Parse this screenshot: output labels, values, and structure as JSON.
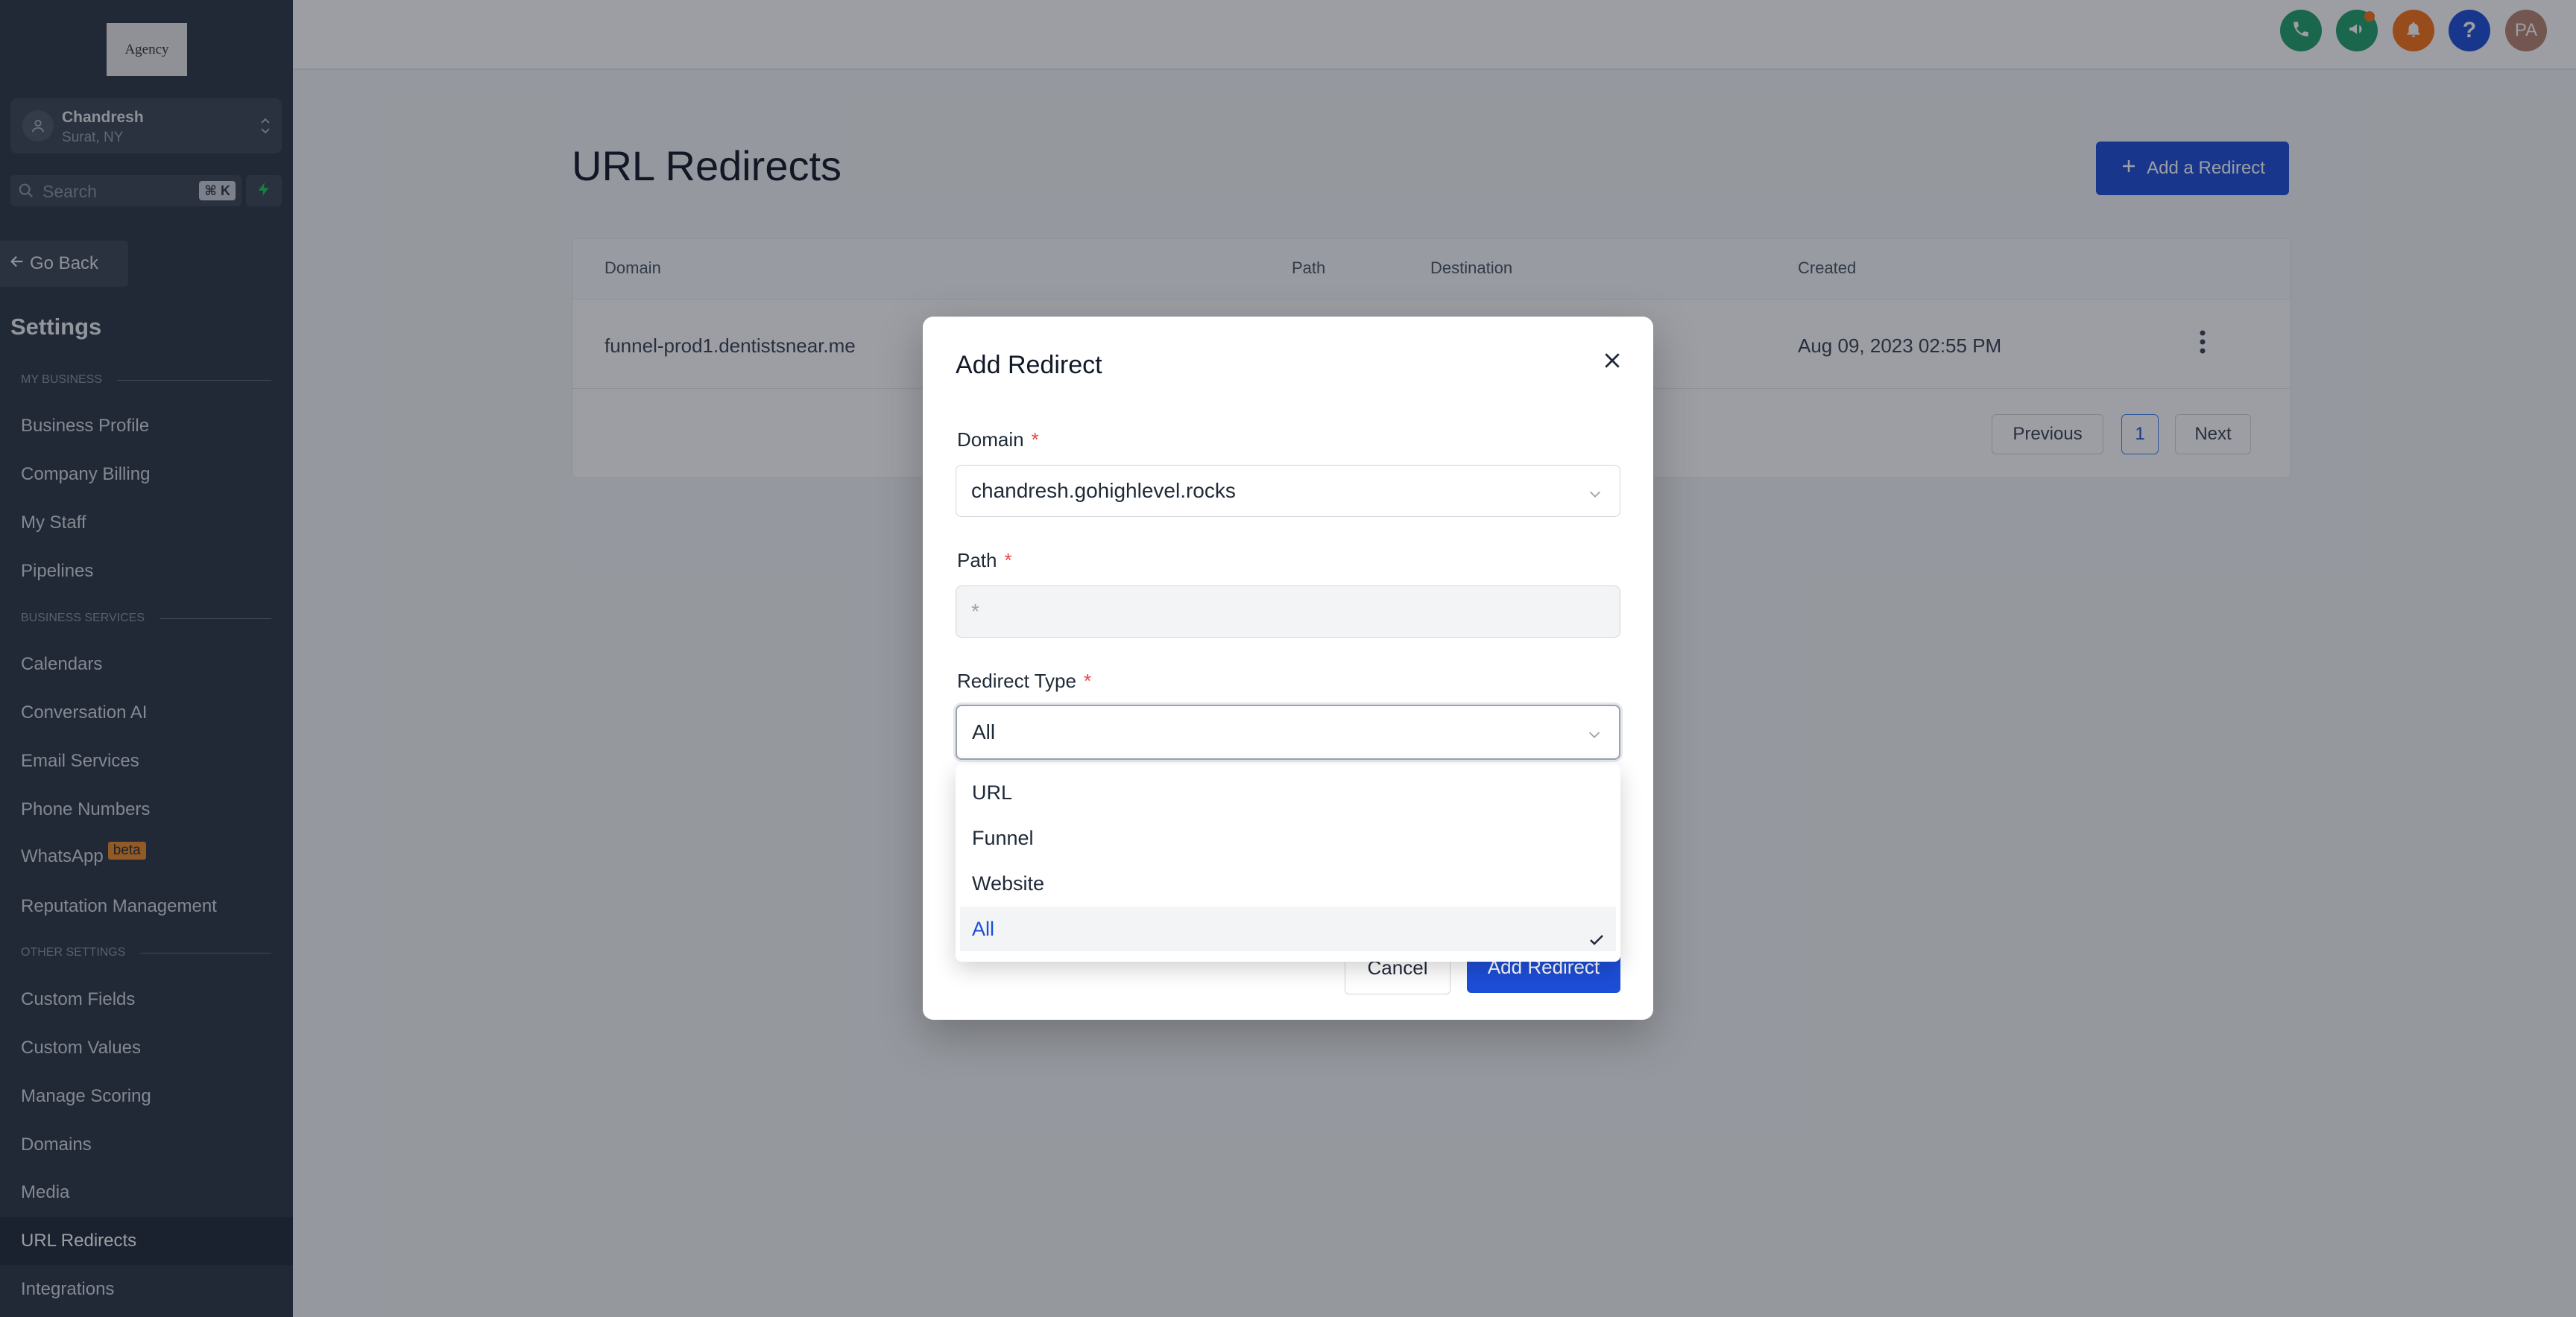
{
  "sidebar": {
    "logo_text": "Agency",
    "account": {
      "name": "Chandresh",
      "location": "Surat, NY"
    },
    "search": {
      "placeholder": "Search",
      "shortcut": "⌘ K"
    },
    "go_back": "Go Back",
    "settings_title": "Settings",
    "sections": {
      "my_business": "MY BUSINESS",
      "business_services": "BUSINESS SERVICES",
      "other_settings": "OTHER SETTINGS"
    },
    "items": {
      "business_profile": "Business Profile",
      "company_billing": "Company Billing",
      "my_staff": "My Staff",
      "pipelines": "Pipelines",
      "calendars": "Calendars",
      "conversation_ai": "Conversation AI",
      "email_services": "Email Services",
      "phone_numbers": "Phone Numbers",
      "whatsapp": "WhatsApp",
      "whatsapp_badge": "beta",
      "reputation_management": "Reputation Management",
      "custom_fields": "Custom Fields",
      "custom_values": "Custom Values",
      "manage_scoring": "Manage Scoring",
      "domains": "Domains",
      "media": "Media",
      "url_redirects": "URL Redirects",
      "integrations": "Integrations"
    }
  },
  "topbar": {
    "user_initials": "PA",
    "help_glyph": "?",
    "colors": {
      "phone": "#22a06b",
      "megaphone": "#22a06b",
      "bell": "#f97316",
      "help": "#1d4ed8",
      "avatar": "#b88471"
    }
  },
  "main": {
    "title": "URL Redirects",
    "add_button": "Add a Redirect",
    "table": {
      "headers": {
        "domain": "Domain",
        "path": "Path",
        "destination": "Destination",
        "created": "Created"
      },
      "rows": [
        {
          "domain": "funnel-prod1.dentistsnear.me",
          "path": "",
          "destination": "",
          "created": "Aug 09, 2023 02:55 PM"
        }
      ]
    },
    "pagination": {
      "previous": "Previous",
      "current": "1",
      "next": "Next"
    }
  },
  "modal": {
    "title": "Add Redirect",
    "domain_label": "Domain",
    "domain_value": "chandresh.gohighlevel.rocks",
    "path_label": "Path",
    "path_placeholder": "*",
    "redirect_type_label": "Redirect Type",
    "redirect_type_value": "All",
    "required_mark": "*",
    "cancel": "Cancel",
    "submit": "Add Redirect",
    "dropdown_options": [
      "URL",
      "Funnel",
      "Website",
      "All"
    ],
    "selected_option": "All"
  },
  "colors": {
    "accent": "#1d4ed8",
    "sidebar_bg": "#2b3544",
    "required": "#ef4444"
  }
}
